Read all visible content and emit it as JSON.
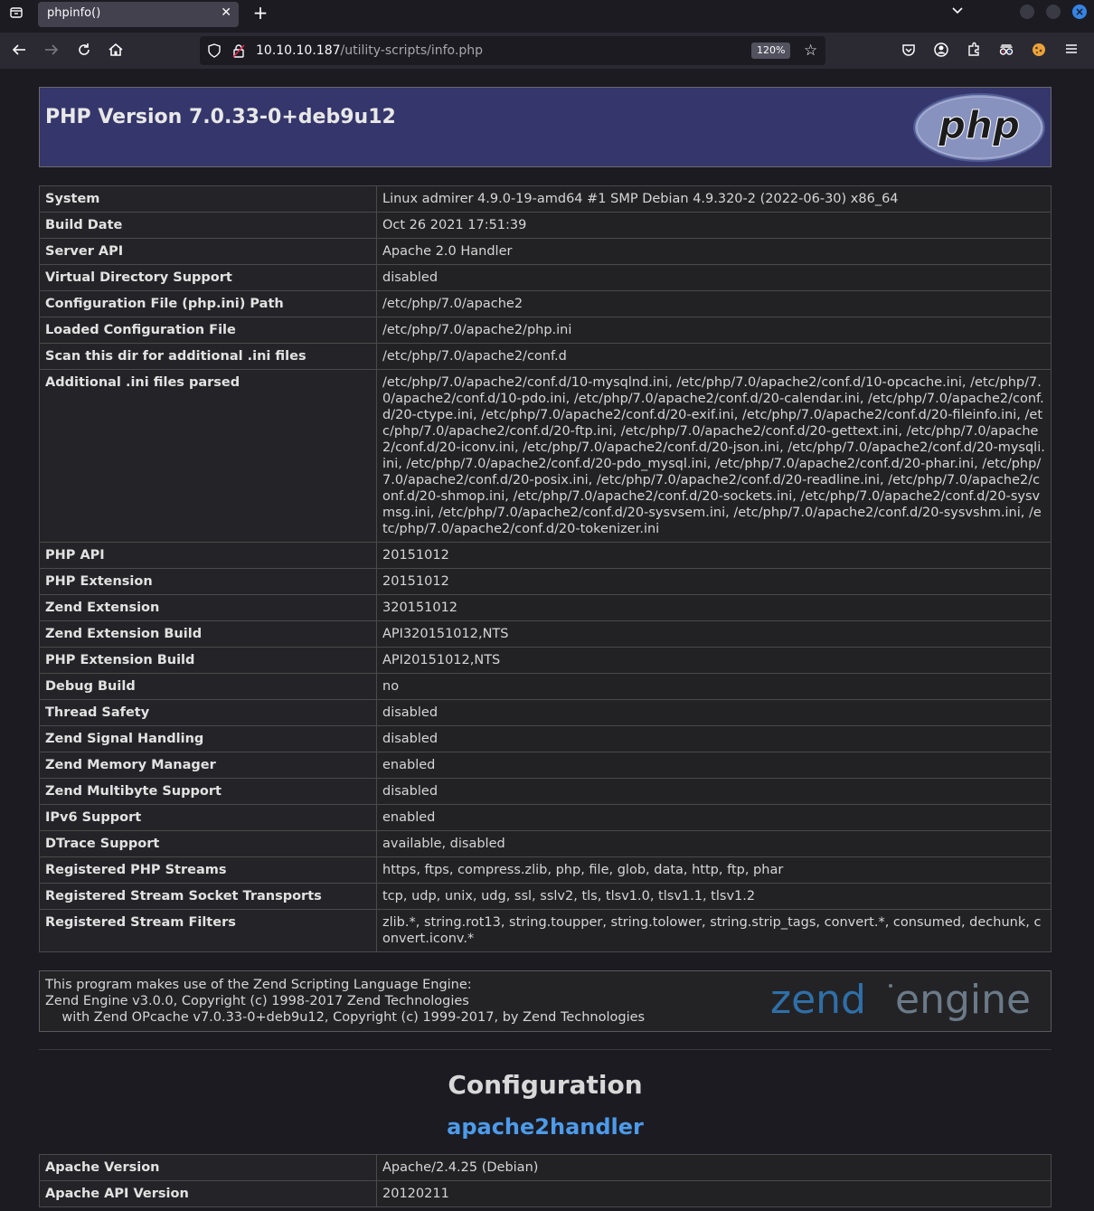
{
  "browser": {
    "tab_title": "phpinfo()",
    "url_host": "10.10.10.187",
    "url_path": "/utility-scripts/info.php",
    "zoom": "120%"
  },
  "header": {
    "version_title": "PHP Version 7.0.33-0+deb9u12",
    "logo_text": "php"
  },
  "info_rows": [
    {
      "k": "System",
      "v": "Linux admirer 4.9.0-19-amd64 #1 SMP Debian 4.9.320-2 (2022-06-30) x86_64"
    },
    {
      "k": "Build Date",
      "v": "Oct 26 2021 17:51:39"
    },
    {
      "k": "Server API",
      "v": "Apache 2.0 Handler"
    },
    {
      "k": "Virtual Directory Support",
      "v": "disabled"
    },
    {
      "k": "Configuration File (php.ini) Path",
      "v": "/etc/php/7.0/apache2"
    },
    {
      "k": "Loaded Configuration File",
      "v": "/etc/php/7.0/apache2/php.ini"
    },
    {
      "k": "Scan this dir for additional .ini files",
      "v": "/etc/php/7.0/apache2/conf.d"
    },
    {
      "k": "Additional .ini files parsed",
      "v": "/etc/php/7.0/apache2/conf.d/10-mysqlnd.ini, /etc/php/7.0/apache2/conf.d/10-opcache.ini, /etc/php/7.0/apache2/conf.d/10-pdo.ini, /etc/php/7.0/apache2/conf.d/20-calendar.ini, /etc/php/7.0/apache2/conf.d/20-ctype.ini, /etc/php/7.0/apache2/conf.d/20-exif.ini, /etc/php/7.0/apache2/conf.d/20-fileinfo.ini, /etc/php/7.0/apache2/conf.d/20-ftp.ini, /etc/php/7.0/apache2/conf.d/20-gettext.ini, /etc/php/7.0/apache2/conf.d/20-iconv.ini, /etc/php/7.0/apache2/conf.d/20-json.ini, /etc/php/7.0/apache2/conf.d/20-mysqli.ini, /etc/php/7.0/apache2/conf.d/20-pdo_mysql.ini, /etc/php/7.0/apache2/conf.d/20-phar.ini, /etc/php/7.0/apache2/conf.d/20-posix.ini, /etc/php/7.0/apache2/conf.d/20-readline.ini, /etc/php/7.0/apache2/conf.d/20-shmop.ini, /etc/php/7.0/apache2/conf.d/20-sockets.ini, /etc/php/7.0/apache2/conf.d/20-sysvmsg.ini, /etc/php/7.0/apache2/conf.d/20-sysvsem.ini, /etc/php/7.0/apache2/conf.d/20-sysvshm.ini, /etc/php/7.0/apache2/conf.d/20-tokenizer.ini"
    },
    {
      "k": "PHP API",
      "v": "20151012"
    },
    {
      "k": "PHP Extension",
      "v": "20151012"
    },
    {
      "k": "Zend Extension",
      "v": "320151012"
    },
    {
      "k": "Zend Extension Build",
      "v": "API320151012,NTS"
    },
    {
      "k": "PHP Extension Build",
      "v": "API20151012,NTS"
    },
    {
      "k": "Debug Build",
      "v": "no"
    },
    {
      "k": "Thread Safety",
      "v": "disabled"
    },
    {
      "k": "Zend Signal Handling",
      "v": "disabled"
    },
    {
      "k": "Zend Memory Manager",
      "v": "enabled"
    },
    {
      "k": "Zend Multibyte Support",
      "v": "disabled"
    },
    {
      "k": "IPv6 Support",
      "v": "enabled"
    },
    {
      "k": "DTrace Support",
      "v": "available, disabled"
    },
    {
      "k": "Registered PHP Streams",
      "v": "https, ftps, compress.zlib, php, file, glob, data, http, ftp, phar"
    },
    {
      "k": "Registered Stream Socket Transports",
      "v": "tcp, udp, unix, udg, ssl, sslv2, tls, tlsv1.0, tlsv1.1, tlsv1.2"
    },
    {
      "k": "Registered Stream Filters",
      "v": "zlib.*, string.rot13, string.toupper, string.tolower, string.strip_tags, convert.*, consumed, dechunk, convert.iconv.*"
    }
  ],
  "zend": {
    "line1": "This program makes use of the Zend Scripting Language Engine:",
    "line2": "Zend Engine v3.0.0, Copyright (c) 1998-2017 Zend Technologies",
    "line3": "    with Zend OPcache v7.0.33-0+deb9u12, Copyright (c) 1999-2017, by Zend Technologies",
    "logo_left": "zend",
    "logo_right": "engine"
  },
  "configuration": {
    "title": "Configuration",
    "module_link": "apache2handler",
    "rows": [
      {
        "k": "Apache Version",
        "v": "Apache/2.4.25 (Debian)"
      },
      {
        "k": "Apache API Version",
        "v": "20120211"
      }
    ]
  }
}
